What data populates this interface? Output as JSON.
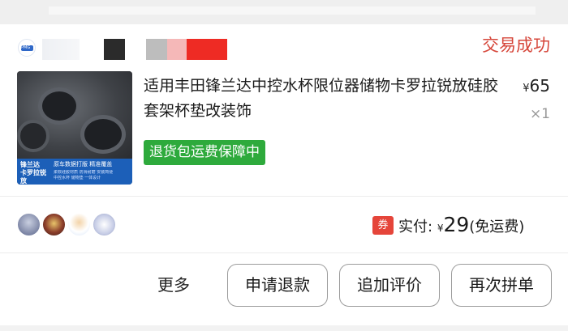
{
  "order": {
    "shop_logo_text": "PMG",
    "status": "交易成功"
  },
  "product": {
    "title": "适用丰田锋兰达中控水杯限位器储物卡罗拉锐放硅胶套架杯垫改装饰",
    "price_currency": "¥",
    "price": "65",
    "quantity": "×1",
    "badge": "退货包运费保障中",
    "thumb": {
      "title_line1": "锋兰达",
      "title_line2": "卡罗拉锐放",
      "tag": "原车数据打版 精准覆盖",
      "sub1": "柔软硅胶材质 防滑耐磨 安装简便",
      "sub2": "中控水杯 储物垫 一体设计"
    }
  },
  "summary": {
    "coupon_label": "券",
    "paid_label": "实付:",
    "currency": "¥",
    "amount": "29",
    "shipping_note": "(免运费)"
  },
  "actions": {
    "more": "更多",
    "refund": "申请退款",
    "review": "追加评价",
    "reorder": "再次拼单"
  },
  "colors": {
    "status": "#d6473b",
    "badge_bg": "#2eaa3c",
    "coupon_bg": "#e5453a"
  }
}
